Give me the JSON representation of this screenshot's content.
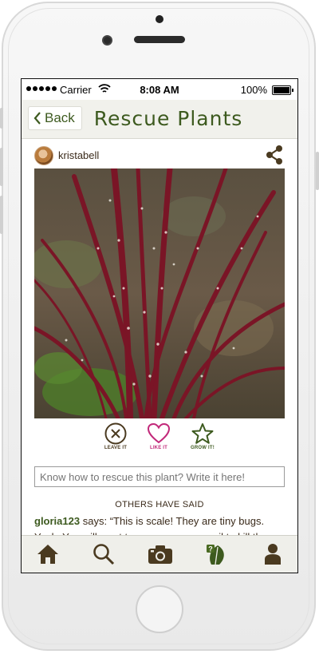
{
  "status_bar": {
    "carrier": "Carrier",
    "time": "8:08 AM",
    "battery": "100%"
  },
  "nav": {
    "back_label": "Back",
    "title": "Rescue Plants"
  },
  "post": {
    "username": "kristabell",
    "photo_icon": "plant-photo"
  },
  "actions": {
    "leave_label": "LEAVE IT",
    "like_label": "LIKE IT",
    "grow_label": "GROW IT!"
  },
  "rescue_input": {
    "placeholder": "Know how to rescue this plant? Write it here!"
  },
  "comments": {
    "heading": "OTHERS HAVE SAID",
    "items": [
      {
        "author": "gloria123",
        "says": "says:",
        "text": "“This is scale! They are tiny bugs. Yuck. You will want to use some neem oil to kill the bugs.”"
      }
    ]
  },
  "tabbar": {
    "items": [
      "home-icon",
      "search-icon",
      "camera-icon",
      "rescue-icon",
      "profile-icon"
    ]
  },
  "colors": {
    "accent": "#3d5a1f",
    "like": "#c2297a",
    "brown": "#4a3a20",
    "nav_bg": "#f1f1ec"
  }
}
